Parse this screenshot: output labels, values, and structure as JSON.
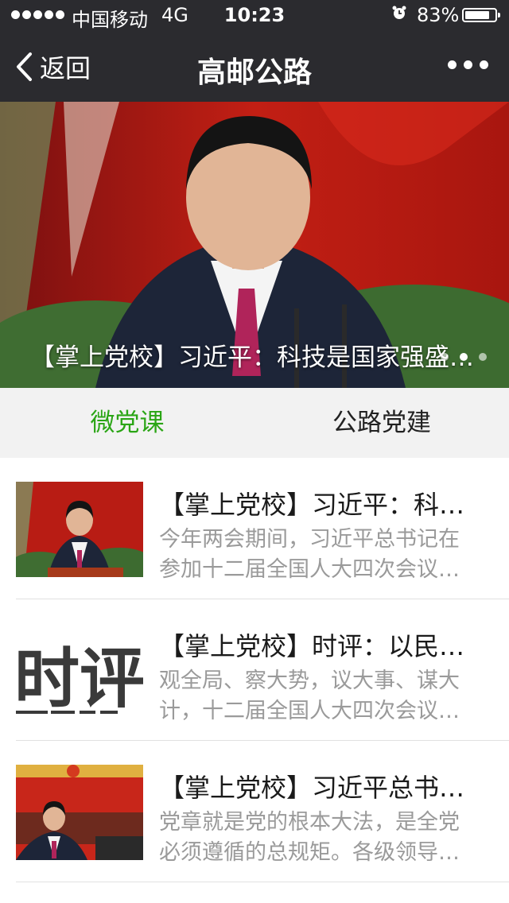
{
  "status_bar": {
    "carrier": "中国移动",
    "network": "4G",
    "time": "10:23",
    "battery_percent": "83%",
    "battery_level": 0.83,
    "signal_bars": 5,
    "alarm_icon": "alarm-clock-icon"
  },
  "nav": {
    "back_label": "返回",
    "title": "高邮公路",
    "more_icon": "more-dots-icon"
  },
  "banner": {
    "caption": "【掌上党校】习近平：科技是国家强盛…",
    "dots": 3,
    "active_dot": 2
  },
  "tabs": [
    {
      "label": "微党课",
      "active": true
    },
    {
      "label": "公路党建",
      "active": false
    }
  ],
  "articles": [
    {
      "title": "【掌上党校】习近平：科…",
      "desc_line1": "今年两会期间，习近平总书记在",
      "desc_line2": "参加十二届全国人大四次会议…",
      "thumb_text": ""
    },
    {
      "title": "【掌上党校】时评：以民…",
      "desc_line1": "观全局、察大势，议大事、谋大",
      "desc_line2": "计，十二届全国人大四次会议…",
      "thumb_text": "时评"
    },
    {
      "title": "【掌上党校】习近平总书…",
      "desc_line1": "党章就是党的根本大法，是全党",
      "desc_line2": "必须遵循的总规矩。各级领导…",
      "thumb_text": ""
    }
  ],
  "colors": {
    "bar_bg": "#2b2b2f",
    "tab_active": "#2aa515",
    "desc_gray": "#9a9a9a"
  }
}
